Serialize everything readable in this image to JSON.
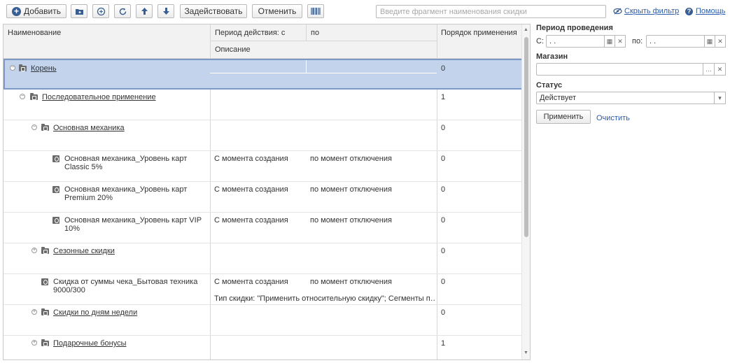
{
  "toolbar": {
    "add_label": "Добавить",
    "activate_label": "Задействовать",
    "cancel_label": "Отменить",
    "search_placeholder": "Введите фрагмент наименования скидки",
    "hide_filter_label": "Скрыть фильтр",
    "help_label": "Помощь"
  },
  "grid": {
    "headers": {
      "name": "Наименование",
      "period_from": "Период действия: с",
      "period_to": "по",
      "description": "Описание",
      "order": "Порядок применения"
    },
    "rows": [
      {
        "name": "Корень",
        "from": "",
        "to": "",
        "desc": "",
        "order": "0"
      },
      {
        "name": "Последовательное применение",
        "from": "",
        "to": "",
        "desc": "",
        "order": "1"
      },
      {
        "name": "Основная механика",
        "from": "",
        "to": "",
        "desc": "",
        "order": "0"
      },
      {
        "name_l1": "Основная механика_Уровень карт",
        "name_l2": "Classic 5%",
        "from": "С момента создания",
        "to": "по момент отключения",
        "desc": "",
        "order": "0"
      },
      {
        "name_l1": "Основная механика_Уровень карт",
        "name_l2": "Premium 20%",
        "from": "С момента создания",
        "to": "по момент отключения",
        "desc": "",
        "order": "0"
      },
      {
        "name_l1": "Основная механика_Уровень карт VIP",
        "name_l2": "10%",
        "from": "С момента создания",
        "to": "по момент отключения",
        "desc": "",
        "order": "0"
      },
      {
        "name": "Сезонные скидки",
        "from": "",
        "to": "",
        "desc": "",
        "order": "0"
      },
      {
        "name_l1": "Скидка от суммы чека_Бытовая техника",
        "name_l2": "9000/300",
        "from": "С момента создания",
        "to": "по момент отключения",
        "desc": "Тип скидки: \"Применить относительную скидку\"; Сегменты п…",
        "order": "0"
      },
      {
        "name": "Скидки по дням недели",
        "from": "",
        "to": "",
        "desc": "",
        "order": "0"
      },
      {
        "name": "Подарочные бонусы",
        "from": "",
        "to": "",
        "desc": "",
        "order": "1"
      }
    ]
  },
  "filter": {
    "period_label": "Период проведения",
    "from_label": "С:",
    "to_label": "по:",
    "date_from": " .  .",
    "date_to": " .  .",
    "store_label": "Магазин",
    "store_value": "",
    "status_label": "Статус",
    "status_value": "Действует",
    "apply_label": "Применить",
    "clear_label": "Очистить"
  }
}
